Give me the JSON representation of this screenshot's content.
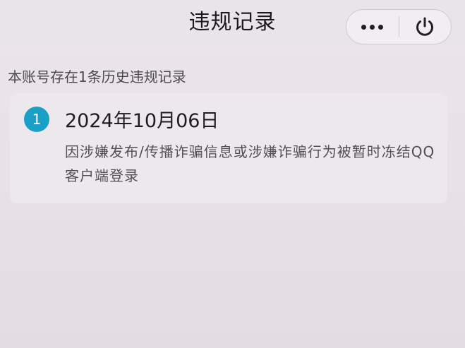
{
  "header": {
    "title": "违规记录"
  },
  "capsule": {
    "more_icon": "more-dots-icon",
    "power_icon": "power-icon"
  },
  "summary": {
    "text": "本账号存在1条历史违规记录"
  },
  "records": [
    {
      "index": "1",
      "date": "2024年10月06日",
      "description": "因涉嫌发布/传播诈骗信息或涉嫌诈骗行为被暂时冻结QQ客户端登录"
    }
  ],
  "colors": {
    "badge": "#1a9fc7",
    "background": "#e9e4e8"
  }
}
